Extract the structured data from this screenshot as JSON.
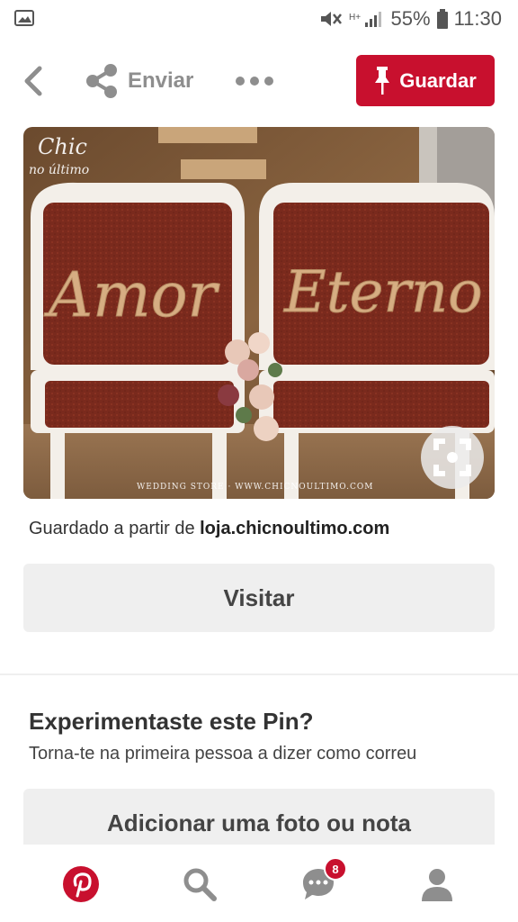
{
  "status_bar": {
    "battery_percent": "55%",
    "time": "11:30",
    "icons": [
      "gallery-icon",
      "mute-icon",
      "signal-icon",
      "battery-icon"
    ]
  },
  "toolbar": {
    "share_label": "Enviar",
    "save_label": "Guardar",
    "accent_color": "#c8102e"
  },
  "pin": {
    "watermark_brand": "Chic",
    "watermark_brand_sub": "no último",
    "sign_left": "Amor",
    "sign_right": "Eterno",
    "footer_watermark": "WEDDING STORE  ·  WWW.CHICNOULTIMO.COM"
  },
  "source": {
    "prefix": "Guardado a partir de ",
    "domain": "loja.chicnoultimo.com"
  },
  "visit_label": "Visitar",
  "tried": {
    "title": "Experimentaste este Pin?",
    "subtitle": "Torna-te na primeira pessoa a dizer como correu",
    "add_label": "Adicionar uma foto ou nota"
  },
  "bottom_nav": {
    "notifications_count": "8",
    "items": [
      "pinterest-home-icon",
      "search-icon",
      "chat-icon",
      "profile-icon"
    ]
  }
}
